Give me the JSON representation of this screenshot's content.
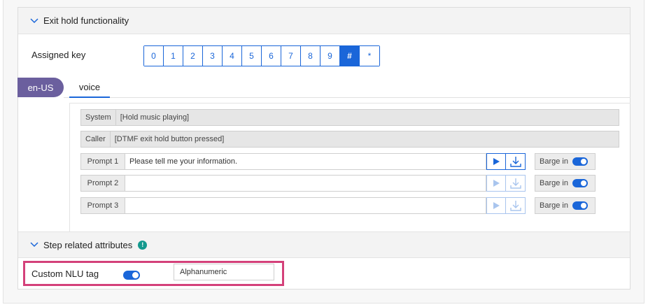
{
  "sections": {
    "exit_hold": {
      "title": "Exit hold functionality"
    },
    "step_attrs": {
      "title": "Step related attributes"
    }
  },
  "assigned_key": {
    "label": "Assigned key",
    "keys": [
      "0",
      "1",
      "2",
      "3",
      "4",
      "5",
      "6",
      "7",
      "8",
      "9",
      "#",
      "*"
    ],
    "selected": "#"
  },
  "language": {
    "label": "en-US"
  },
  "tabs": {
    "voice": "voice"
  },
  "system_row": {
    "label": "System",
    "value": "[Hold music playing]"
  },
  "caller_row": {
    "label": "Caller",
    "value": "[DTMF exit hold button pressed]"
  },
  "prompts": [
    {
      "label": "Prompt 1",
      "value": "Please tell me your information.",
      "barge_label": "Barge in",
      "barge_on": true
    },
    {
      "label": "Prompt 2",
      "value": "",
      "barge_label": "Barge in",
      "barge_on": true
    },
    {
      "label": "Prompt 3",
      "value": "",
      "barge_label": "Barge in",
      "barge_on": true
    }
  ],
  "custom_nlu": {
    "label": "Custom NLU tag",
    "enabled": true,
    "value": "Alphanumeric"
  },
  "colors": {
    "accent": "#1a66d9",
    "language_pill": "#6b5f9e",
    "highlight": "#d4417a",
    "info": "#14998e"
  }
}
